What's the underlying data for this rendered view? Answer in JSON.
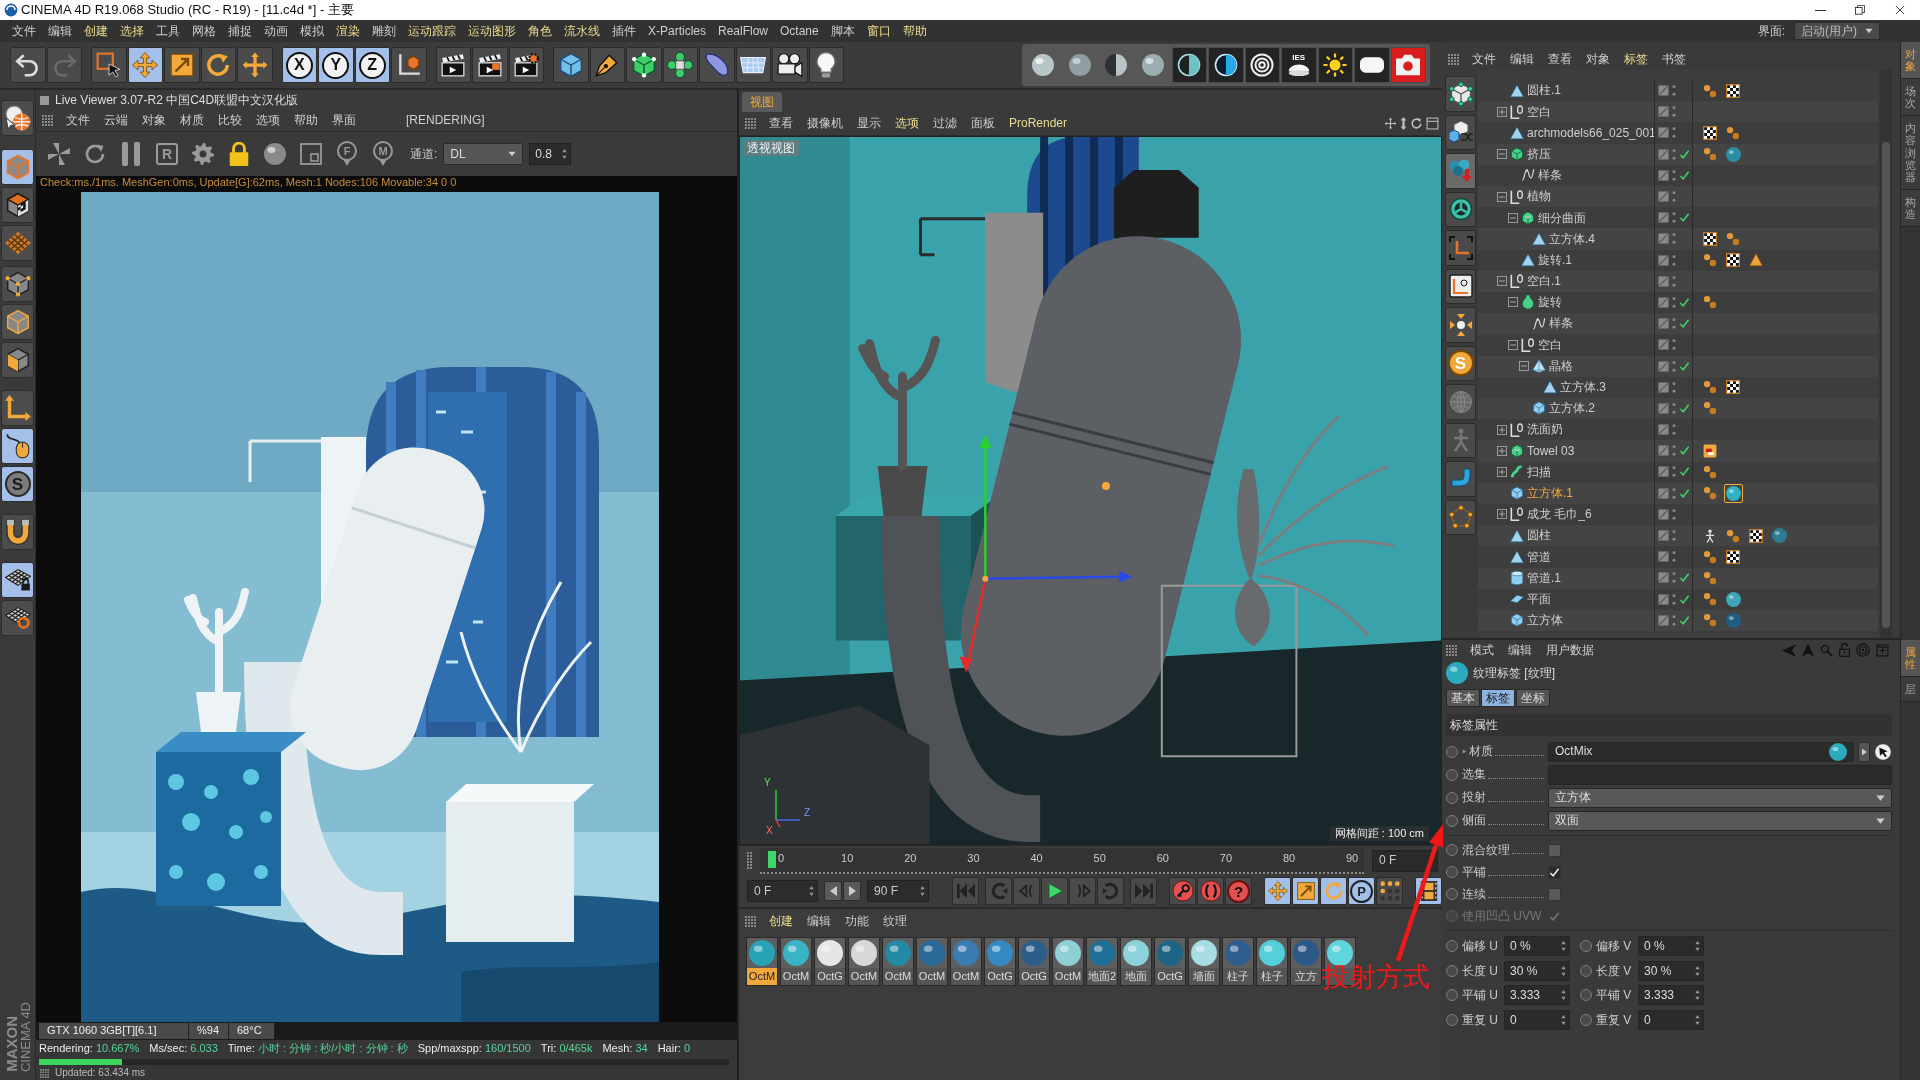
{
  "window": {
    "title": "CINEMA 4D R19.068 Studio (RC - R19) - [11.c4d *] - 主要"
  },
  "menu_bar": {
    "items": [
      {
        "label": "文件",
        "highlighted": false
      },
      {
        "label": "编辑",
        "highlighted": false
      },
      {
        "label": "创建",
        "highlighted": true
      },
      {
        "label": "选择",
        "highlighted": true
      },
      {
        "label": "工具",
        "highlighted": false
      },
      {
        "label": "网格",
        "highlighted": false
      },
      {
        "label": "捕捉",
        "highlighted": false
      },
      {
        "label": "动画",
        "highlighted": false
      },
      {
        "label": "模拟",
        "highlighted": false
      },
      {
        "label": "渲染",
        "highlighted": true
      },
      {
        "label": "雕刻",
        "highlighted": false
      },
      {
        "label": "运动跟踪",
        "highlighted": true
      },
      {
        "label": "运动图形",
        "highlighted": true
      },
      {
        "label": "角色",
        "highlighted": true
      },
      {
        "label": "流水线",
        "highlighted": true
      },
      {
        "label": "插件",
        "highlighted": false
      },
      {
        "label": "X-Particles",
        "highlighted": false
      },
      {
        "label": "RealFlow",
        "highlighted": false
      },
      {
        "label": "Octane",
        "highlighted": false
      },
      {
        "label": "脚本",
        "highlighted": false
      },
      {
        "label": "窗口",
        "highlighted": true
      },
      {
        "label": "帮助",
        "highlighted": true
      }
    ],
    "layout_label": "界面:",
    "layout_value": "启动(用户)"
  },
  "main_toolbar": {
    "groups": [
      [
        {
          "kind": "undo",
          "active": false,
          "disabled": false
        },
        {
          "kind": "redo",
          "active": false,
          "disabled": true
        }
      ],
      [
        {
          "kind": "live-select",
          "active": false,
          "disabled": false
        },
        {
          "kind": "move",
          "active": true,
          "disabled": false
        },
        {
          "kind": "scale",
          "active": false,
          "disabled": false
        },
        {
          "kind": "rotate",
          "active": false,
          "disabled": false
        },
        {
          "kind": "add-tool",
          "active": false,
          "disabled": false
        }
      ],
      [
        {
          "kind": "axis",
          "label": "X",
          "active": true,
          "disabled": false
        },
        {
          "kind": "axis",
          "label": "Y",
          "active": true,
          "disabled": false
        },
        {
          "kind": "axis",
          "label": "Z",
          "active": true,
          "disabled": false
        },
        {
          "kind": "coord-system",
          "active": false,
          "disabled": false
        }
      ],
      [
        {
          "kind": "render-view",
          "active": false,
          "disabled": false
        },
        {
          "kind": "render-picture",
          "active": false,
          "disabled": false
        },
        {
          "kind": "render-settings",
          "active": false,
          "disabled": false
        }
      ],
      [
        {
          "kind": "cube",
          "active": false,
          "disabled": false
        },
        {
          "kind": "pen",
          "active": false,
          "disabled": false
        },
        {
          "kind": "cube-points",
          "active": false,
          "disabled": false
        },
        {
          "kind": "subdivide",
          "active": false,
          "disabled": false
        },
        {
          "kind": "deformer",
          "active": false,
          "disabled": false
        },
        {
          "kind": "floor",
          "active": false,
          "disabled": false
        },
        {
          "kind": "camera",
          "active": false,
          "disabled": false
        },
        {
          "kind": "light",
          "active": false,
          "disabled": false
        }
      ]
    ]
  },
  "render_toolbar": {
    "items": [
      {
        "kind": "sphere-light"
      },
      {
        "kind": "sphere-mid"
      },
      {
        "kind": "sphere-half"
      },
      {
        "kind": "sphere-soft"
      },
      {
        "kind": "half-circle"
      },
      {
        "kind": "half-circle-blue"
      },
      {
        "kind": "rings"
      },
      {
        "kind": "ies",
        "label": "IES"
      },
      {
        "kind": "sun"
      },
      {
        "kind": "panel"
      },
      {
        "kind": "render-camera"
      }
    ]
  },
  "left_toolbar": {
    "groups": [
      [
        {
          "kind": "logo",
          "active": false
        }
      ],
      [
        {
          "kind": "model-cube",
          "active": true
        },
        {
          "kind": "tiled-cube",
          "active": false
        },
        {
          "kind": "grid-plane",
          "active": false
        }
      ],
      [
        {
          "kind": "points",
          "active": false
        },
        {
          "kind": "edges",
          "active": false
        },
        {
          "kind": "polygons",
          "active": false
        }
      ],
      [
        {
          "kind": "axes",
          "active": false
        },
        {
          "kind": "mouse",
          "active": true
        },
        {
          "kind": "letter-disc",
          "label": "S",
          "active": true
        }
      ],
      [
        {
          "kind": "magnet",
          "active": false
        }
      ],
      [
        {
          "kind": "tiled-plane-lock",
          "active": true
        },
        {
          "kind": "tiled-plane-ring",
          "active": false
        }
      ]
    ],
    "logo": [
      "MAXON",
      "CINEMA 4D"
    ]
  },
  "live_viewer": {
    "title": "Live Viewer 3.07-R2 中国C4D联盟中文汉化版",
    "menu": [
      "文件",
      "云端",
      "对象",
      "材质",
      "比较",
      "选项",
      "帮助",
      "界面"
    ],
    "status": "[RENDERING]",
    "toolbar": [
      {
        "kind": "pinwheel"
      },
      {
        "kind": "refresh"
      },
      {
        "kind": "pause"
      },
      {
        "kind": "letter-box",
        "label": "R"
      },
      {
        "kind": "settings"
      },
      {
        "kind": "lock"
      },
      {
        "kind": "sphere"
      },
      {
        "kind": "region"
      },
      {
        "kind": "pin",
        "label": "F"
      },
      {
        "kind": "pin",
        "label": "M"
      }
    ],
    "channel_label": "通道:",
    "channel_value": "DL",
    "value": "0.8",
    "log": "Check:ms./1ms. MeshGen:0ms, Update[G]:62ms, Mesh:1 Nodes:106 Movable:34  0  0",
    "gpu": [
      "GTX 1060 3GB[T][6.1]",
      "%94",
      "68°C"
    ],
    "stats": [
      {
        "label": "Rendering:",
        "value": "10.667%"
      },
      {
        "label": "Ms/sec:",
        "value": "6.033"
      },
      {
        "label": "Time:",
        "value": "小时 : 分钟 : 秒/小时 : 分钟 : 秒"
      },
      {
        "label": "Spp/maxspp:",
        "value": "160/1500"
      },
      {
        "label": "Tri:",
        "value": "0/465k"
      },
      {
        "label": "Mesh:",
        "value": "34"
      },
      {
        "label": "Hair:",
        "value": "0"
      }
    ],
    "progress": {
      "level": 0.12
    },
    "updated": "Updated: 63.434 ms"
  },
  "viewport": {
    "tab": {
      "label": "视图",
      "selected": true
    },
    "menu": [
      {
        "label": "查看",
        "highlighted": false
      },
      {
        "label": "摄像机",
        "highlighted": false
      },
      {
        "label": "显示",
        "highlighted": false
      },
      {
        "label": "选项",
        "highlighted": true
      },
      {
        "label": "过滤",
        "highlighted": false
      },
      {
        "label": "面板",
        "highlighted": false
      },
      {
        "label": "ProRender",
        "highlighted": true
      }
    ],
    "view_name": "透视视图",
    "grid_spacing": "网格间距 : 100 cm",
    "axis_labels": [
      "Y",
      "Z",
      "X"
    ]
  },
  "timeline": {
    "ticks": [
      "0",
      "10",
      "20",
      "30",
      "40",
      "50",
      "60",
      "70",
      "80",
      "90"
    ],
    "playhead": {
      "level": 0
    },
    "frame": "0 F"
  },
  "transport": {
    "start": "0 F",
    "end": "90 F",
    "playback": [
      {
        "kind": "to-start"
      },
      {
        "kind": "prev-key"
      },
      {
        "kind": "prev-frame"
      },
      {
        "kind": "play"
      },
      {
        "kind": "next-frame"
      },
      {
        "kind": "next-key"
      },
      {
        "kind": "to-end"
      }
    ],
    "keys": [
      {
        "kind": "key-record"
      },
      {
        "kind": "key-auto"
      },
      {
        "kind": "key-help",
        "label": "?"
      }
    ],
    "tools": [
      {
        "kind": "move",
        "active": true
      },
      {
        "kind": "scale",
        "active": true
      },
      {
        "kind": "rotate",
        "active": true
      },
      {
        "kind": "letter-ring",
        "label": "P",
        "active": true
      },
      {
        "kind": "dots",
        "active": false
      },
      {
        "kind": "film",
        "active": true
      }
    ]
  },
  "material_manager": {
    "menu": [
      {
        "label": "创建",
        "highlighted": true
      },
      {
        "label": "编辑",
        "highlighted": false
      },
      {
        "label": "功能",
        "highlighted": false
      },
      {
        "label": "纹理",
        "highlighted": false
      }
    ],
    "materials": [
      {
        "name": "OctM",
        "color": "#27a3b5",
        "selected": true
      },
      {
        "name": "OctM",
        "color": "#3ab3c4",
        "selected": false
      },
      {
        "name": "OctG",
        "color": "#e6e6e6",
        "selected": false
      },
      {
        "name": "OctM",
        "color": "#d8d8d8",
        "selected": false
      },
      {
        "name": "OctM",
        "color": "#238aa3",
        "selected": false
      },
      {
        "name": "OctM",
        "color": "#2a6a98",
        "selected": false
      },
      {
        "name": "OctM",
        "color": "#3a7cb0",
        "selected": false
      },
      {
        "name": "OctG",
        "color": "#3589c2",
        "selected": false
      },
      {
        "name": "OctG",
        "color": "#2c5e8a",
        "selected": false
      },
      {
        "name": "OctM",
        "color": "#8fcfd6",
        "selected": false
      },
      {
        "name": "地面2",
        "color": "#1f6e95",
        "selected": false
      },
      {
        "name": "地面",
        "color": "#8bd2db",
        "selected": false
      },
      {
        "name": "OctG",
        "color": "#1d6485",
        "selected": false
      },
      {
        "name": "墙面",
        "color": "#a6dce2",
        "selected": false
      },
      {
        "name": "柱子",
        "color": "#2e5e8e",
        "selected": false
      },
      {
        "name": "柱子",
        "color": "#55cfdb",
        "selected": false
      },
      {
        "name": "立方",
        "color": "#2c5a88",
        "selected": false
      },
      {
        "color": "#5fd5df",
        "selected": false
      }
    ]
  },
  "object_manager": {
    "menu": [
      {
        "label": "文件",
        "highlighted": false
      },
      {
        "label": "编辑",
        "highlighted": false
      },
      {
        "label": "查看",
        "highlighted": false
      },
      {
        "label": "对象",
        "highlighted": false
      },
      {
        "label": "标签",
        "highlighted": true
      },
      {
        "label": "书签",
        "highlighted": false
      }
    ],
    "tools": [
      {
        "kind": "cube-nodes",
        "active": false
      },
      {
        "kind": "cubes-shuffle",
        "active": false
      },
      {
        "kind": "spheres-arrow",
        "active": true
      },
      {
        "kind": "wheel",
        "active": false
      },
      {
        "kind": "brackets",
        "active": false
      },
      {
        "kind": "coord-box",
        "active": false
      },
      {
        "kind": "light-arrows",
        "active": false
      },
      {
        "kind": "letter-circle",
        "label": "S",
        "active": false
      },
      {
        "kind": "mesh-sphere",
        "active": false
      },
      {
        "kind": "figure",
        "active": false
      },
      {
        "kind": "pipe",
        "active": false
      },
      {
        "kind": "pentagon",
        "active": false
      }
    ],
    "objects": [
      {
        "name": "圆柱.1",
        "kind": "polygon",
        "selected": false,
        "enabled": false,
        "tags": [
          {
            "kind": "phong",
            "selected": false
          },
          {
            "kind": "uvw",
            "selected": false
          }
        ]
      },
      {
        "name": "空白",
        "kind": "null",
        "selected": false,
        "enabled": false,
        "expanded": false
      },
      {
        "name": "archmodels66_025_001",
        "kind": "polygon",
        "selected": false,
        "enabled": false,
        "tags": [
          {
            "kind": "uvw",
            "selected": false
          },
          {
            "kind": "phong",
            "selected": false
          }
        ]
      },
      {
        "name": "挤压",
        "kind": "extrude",
        "selected": false,
        "enabled": true,
        "expanded": true,
        "tags": [
          {
            "kind": "phong",
            "selected": false
          },
          {
            "kind": "material",
            "color": "#2b8fa3",
            "selected": false
          }
        ],
        "children": [
          {
            "name": "样条",
            "kind": "spline",
            "selected": false,
            "enabled": true
          }
        ]
      },
      {
        "name": "植物",
        "kind": "null",
        "selected": false,
        "enabled": false,
        "expanded": true,
        "children": [
          {
            "name": "细分曲面",
            "kind": "subdivision",
            "selected": false,
            "enabled": true,
            "expanded": true,
            "children": [
              {
                "name": "立方体.4",
                "kind": "polygon",
                "selected": false,
                "enabled": false,
                "tags": [
                  {
                    "kind": "uvw",
                    "selected": false
                  },
                  {
                    "kind": "phong",
                    "selected": false
                  }
                ]
              }
            ]
          },
          {
            "name": "旋转.1",
            "kind": "polygon",
            "selected": false,
            "enabled": false,
            "tags": [
              {
                "kind": "phong",
                "selected": false
              },
              {
                "kind": "uvw",
                "selected": false
              },
              {
                "kind": "warning",
                "selected": false
              }
            ]
          }
        ]
      },
      {
        "name": "空白.1",
        "kind": "null",
        "selected": false,
        "enabled": false,
        "expanded": true,
        "children": [
          {
            "name": "旋转",
            "kind": "lathe",
            "selected": false,
            "enabled": true,
            "expanded": true,
            "tags": [
              {
                "kind": "phong",
                "selected": false
              }
            ],
            "children": [
              {
                "name": "样条",
                "kind": "spline",
                "selected": false,
                "enabled": true
              }
            ]
          },
          {
            "name": "空白",
            "kind": "null",
            "selected": false,
            "enabled": false,
            "expanded": true,
            "children": [
              {
                "name": "晶格",
                "kind": "lattice",
                "selected": false,
                "enabled": true,
                "expanded": true,
                "children": [
                  {
                    "name": "立方体.3",
                    "kind": "polygon",
                    "selected": false,
                    "enabled": false,
                    "tags": [
                      {
                        "kind": "phong",
                        "selected": false
                      },
                      {
                        "kind": "uvw",
                        "selected": false
                      }
                    ]
                  }
                ]
              },
              {
                "name": "立方体.2",
                "kind": "cube",
                "selected": false,
                "enabled": true,
                "tags": [
                  {
                    "kind": "phong",
                    "selected": false
                  }
                ]
              }
            ]
          }
        ]
      },
      {
        "name": "洗面奶",
        "kind": "null",
        "selected": false,
        "enabled": false,
        "expanded": false
      },
      {
        "name": "Towel 03",
        "kind": "subdivision",
        "selected": false,
        "enabled": true,
        "expanded": false,
        "tags": [
          {
            "kind": "selection",
            "selected": false
          }
        ]
      },
      {
        "name": "扫描",
        "kind": "sweep",
        "selected": false,
        "enabled": true,
        "expanded": false,
        "tags": [
          {
            "kind": "phong",
            "selected": false
          }
        ]
      },
      {
        "name": "立方体.1",
        "kind": "cube",
        "selected": true,
        "enabled": true,
        "tags": [
          {
            "kind": "phong",
            "selected": false
          },
          {
            "kind": "material",
            "color": "#2fb3c4",
            "selected": true
          }
        ]
      },
      {
        "name": "成龙 毛巾_6",
        "kind": "null",
        "selected": false,
        "enabled": false,
        "expanded": false
      },
      {
        "name": "圆柱",
        "kind": "polygon",
        "selected": false,
        "enabled": false,
        "tags": [
          {
            "kind": "xpresso",
            "selected": false
          },
          {
            "kind": "phong",
            "selected": false
          },
          {
            "kind": "uvw",
            "selected": false
          },
          {
            "kind": "material",
            "color": "#2a7d92",
            "selected": false
          }
        ]
      },
      {
        "name": "管道",
        "kind": "polygon",
        "selected": false,
        "enabled": false,
        "tags": [
          {
            "kind": "phong",
            "selected": false
          },
          {
            "kind": "uvw",
            "selected": false
          }
        ]
      },
      {
        "name": "管道.1",
        "kind": "tube",
        "selected": false,
        "enabled": true,
        "tags": [
          {
            "kind": "phong",
            "selected": false
          }
        ]
      },
      {
        "name": "平面",
        "kind": "plane",
        "selected": false,
        "enabled": true,
        "tags": [
          {
            "kind": "phong",
            "selected": false
          },
          {
            "kind": "material",
            "color": "#3ea4b6",
            "selected": false
          }
        ]
      },
      {
        "name": "立方体",
        "kind": "cube",
        "selected": false,
        "enabled": true,
        "tags": [
          {
            "kind": "phong",
            "selected": false
          },
          {
            "kind": "material",
            "color": "#1f5f84",
            "selected": false
          }
        ]
      }
    ],
    "side_tabs": [
      {
        "label": "对象",
        "selected": true
      },
      {
        "label": "场次",
        "selected": false
      },
      {
        "label": "内容浏览器",
        "selected": false
      },
      {
        "label": "构造",
        "selected": false
      }
    ]
  },
  "attributes": {
    "menu": [
      "模式",
      "编辑",
      "用户数据"
    ],
    "title": "纹理标签 [纹理]",
    "tabs": [
      {
        "label": "基本",
        "selected": false
      },
      {
        "label": "标签",
        "selected": true
      },
      {
        "label": "坐标",
        "selected": false
      }
    ],
    "section": "标签属性",
    "fields": [
      {
        "kind": "link",
        "label": "材质",
        "value": "OctMix"
      },
      {
        "kind": "text",
        "label": "选集"
      },
      {
        "kind": "dropdown",
        "label": "投射",
        "value": "立方体"
      },
      {
        "kind": "dropdown",
        "label": "侧面",
        "value": "双面"
      }
    ],
    "options": [
      {
        "label": "混合纹理",
        "checked": false,
        "disabled": false
      },
      {
        "label": "平铺",
        "checked": true,
        "disabled": false
      },
      {
        "label": "连续",
        "checked": false,
        "disabled": false
      },
      {
        "label": "使用凹凸 UVW",
        "checked": true,
        "disabled": true
      }
    ],
    "numbers": [
      {
        "label": "偏移 U",
        "value": "0 %"
      },
      {
        "label": "偏移 V",
        "value": "0 %"
      },
      {
        "label": "长度 U",
        "value": "30 %"
      },
      {
        "label": "长度 V",
        "value": "30 %"
      },
      {
        "label": "平铺 U",
        "value": "3.333"
      },
      {
        "label": "平铺 V",
        "value": "3.333"
      },
      {
        "label": "重复 U",
        "value": "0"
      },
      {
        "label": "重复 V",
        "value": "0"
      }
    ],
    "side_tabs": [
      {
        "label": "属性",
        "selected": true
      },
      {
        "label": "层",
        "selected": false
      }
    ]
  },
  "annotation": {
    "text": "投射方式"
  }
}
